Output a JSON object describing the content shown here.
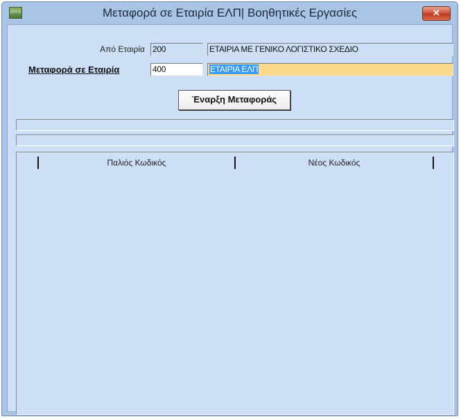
{
  "window": {
    "title": "Μεταφορά σε Εταιρία ΕΛΠ| Βοηθητικές Εργασίες",
    "app_icon_text": "ΕΡΓΑ",
    "close_label": "✕"
  },
  "form": {
    "from_company": {
      "label": "Από Εταιρία",
      "code": "200",
      "name": "ΕΤΑΙΡΙΑ ΜΕ ΓΕΝΙΚΟ ΛΟΓΙΣΤΙΚΟ ΣΧΕΔΙΟ"
    },
    "to_company": {
      "label": "Μεταφορά σε Εταιρία",
      "code": "400",
      "name": "ΕΤΑΙΡΙΑ ΕΛΠ"
    },
    "start_button_label": "Έναρξη Μεταφοράς"
  },
  "grid": {
    "columns": [
      "Παλιός Κωδικός",
      "Νέος Κωδικός"
    ]
  },
  "colors": {
    "client_bg": "#ccdff6",
    "highlight": "#fbd98b",
    "selection": "#3399ff"
  }
}
